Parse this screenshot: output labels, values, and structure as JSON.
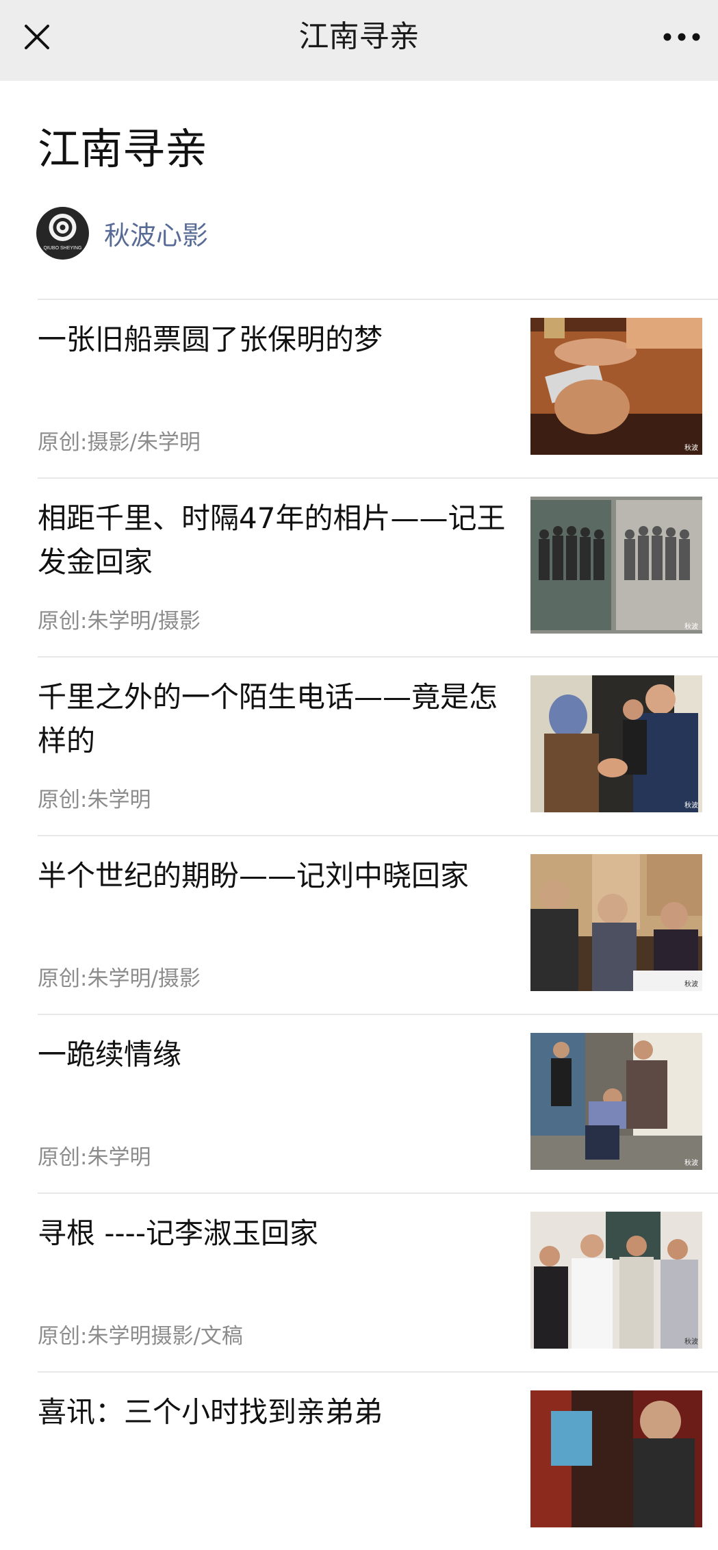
{
  "header": {
    "title": "江南寻亲"
  },
  "page": {
    "title": "江南寻亲"
  },
  "author": {
    "name": "秋波心影",
    "avatar_text": "QIUBO SHEYING"
  },
  "articles": [
    {
      "title": "一张旧船票圆了张保明的梦",
      "meta": "原创:摄影/朱学明",
      "thumb_wm": "秋波"
    },
    {
      "title": "相距千里、时隔47年的相片——记王发金回家",
      "meta": "原创:朱学明/摄影",
      "thumb_wm": "秋波"
    },
    {
      "title": "千里之外的一个陌生电话——竟是怎样的",
      "meta": "原创:朱学明",
      "thumb_wm": "秋波"
    },
    {
      "title": "半个世纪的期盼——记刘中晓回家",
      "meta": "原创:朱学明/摄影",
      "thumb_wm": "秋波"
    },
    {
      "title": "一跪续情缘",
      "meta": "原创:朱学明",
      "thumb_wm": "秋波"
    },
    {
      "title": "寻根 ----记李淑玉回家",
      "meta": "原创:朱学明摄影/文稿",
      "thumb_wm": "秋波"
    },
    {
      "title": "喜讯：三个小时找到亲弟弟",
      "meta": "",
      "thumb_wm": ""
    }
  ]
}
